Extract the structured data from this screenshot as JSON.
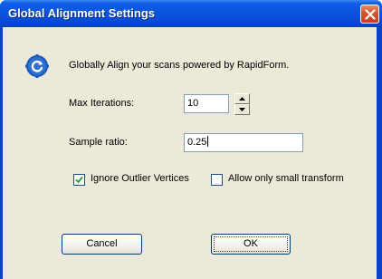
{
  "window": {
    "title": "Global Alignment Settings"
  },
  "intro": {
    "text": "Globally Align your scans powered by RapidForm.",
    "icon": "refresh-icon"
  },
  "fields": {
    "max_iterations": {
      "label": "Max Iterations:",
      "value": "10"
    },
    "sample_ratio": {
      "label": "Sample ratio:",
      "value": "0.25"
    }
  },
  "options": {
    "ignore_outlier": {
      "label": "Ignore Outlier Vertices",
      "checked": true
    },
    "small_transform": {
      "label": "Allow only small transform",
      "checked": false
    }
  },
  "buttons": {
    "cancel": "Cancel",
    "ok": "OK"
  },
  "colors": {
    "titlebar": "#0a53dd",
    "close_button": "#d6532c",
    "client_background": "#ece9d8",
    "icon": "#1a57b8"
  }
}
